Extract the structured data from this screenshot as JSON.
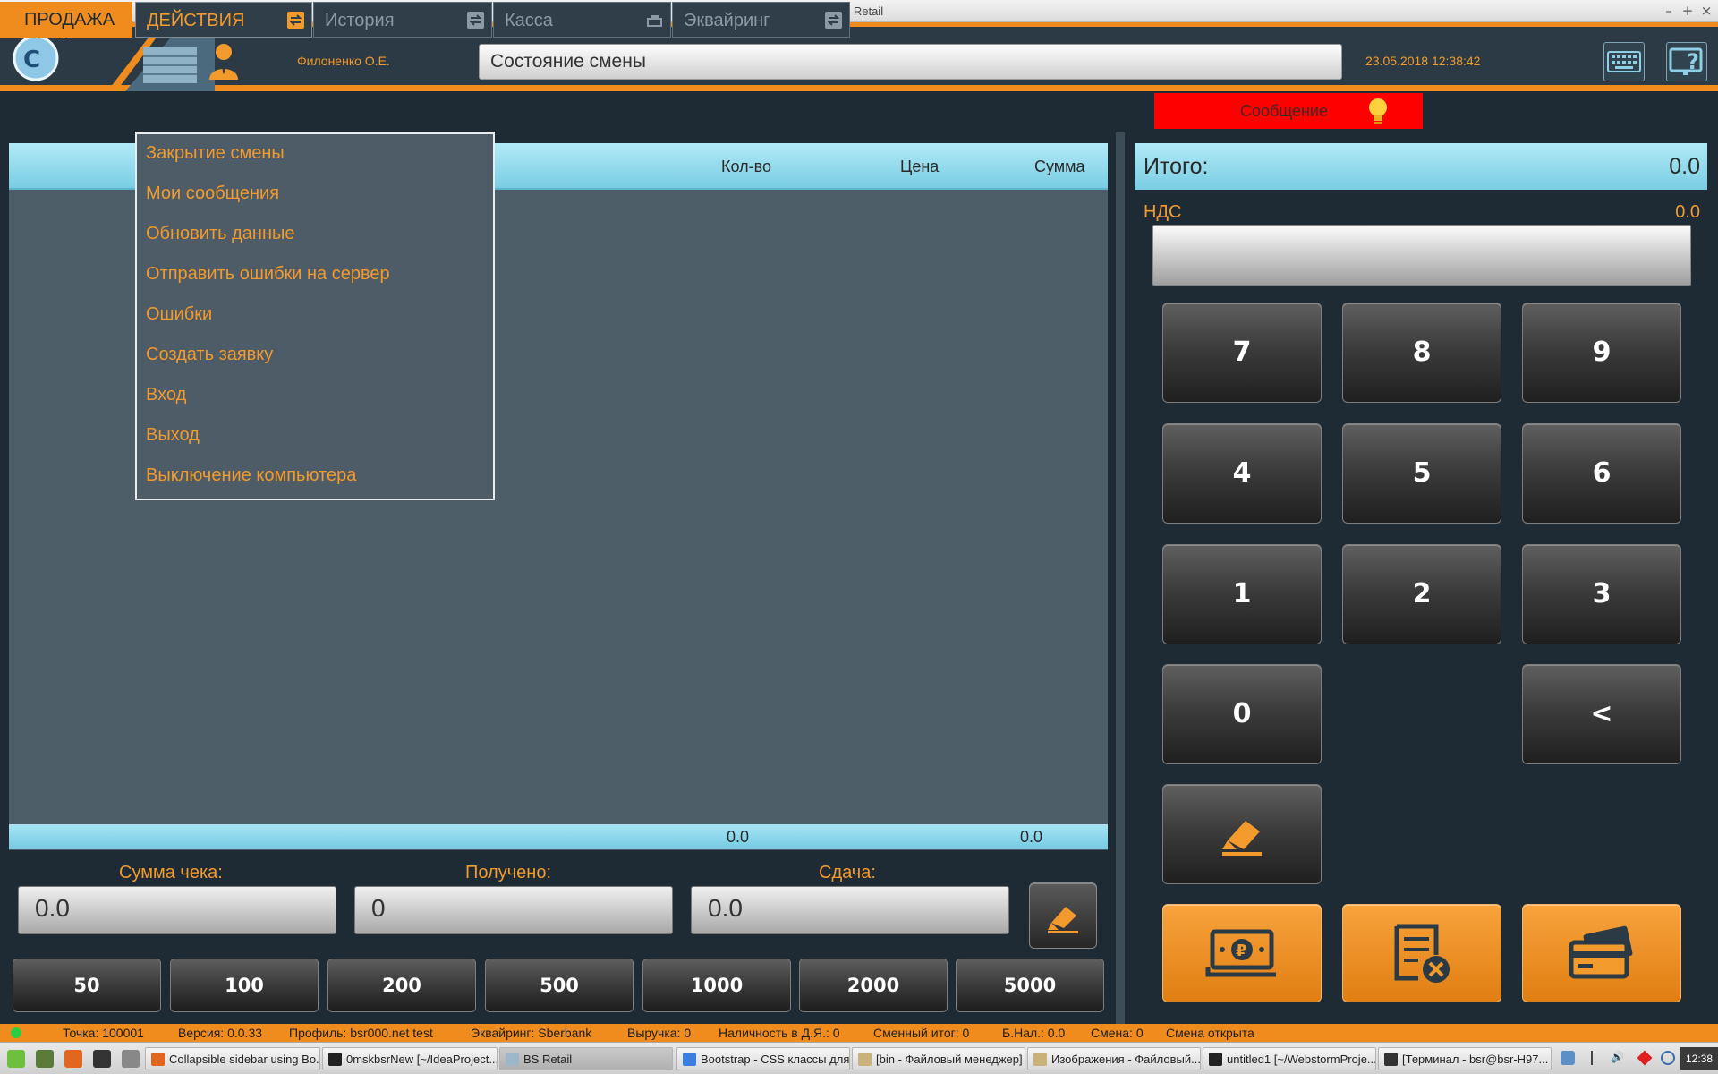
{
  "window": {
    "title": "BS Retail"
  },
  "header": {
    "user_name": "Филоненко О.Е.",
    "shift_state": "Состояние смены",
    "datetime": "23.05.2018 12:38:42"
  },
  "tabs": {
    "sale": "ПРОДАЖА",
    "actions": "ДЕЙСТВИЯ",
    "history": "История",
    "cash": "Касса",
    "acquiring": "Эквайринг"
  },
  "message_label": "Сообщение",
  "actions_menu": [
    "Закрытие смены",
    "Мои сообщения",
    "Обновить данные",
    "Отправить ошибки на сервер",
    "Ошибки",
    "Создать заявку",
    "Вход",
    "Выход",
    "Выключение компьютера"
  ],
  "table": {
    "col_qty": "Кол-во",
    "col_price": "Цена",
    "col_sum": "Сумма",
    "foot_qty": "0.0",
    "foot_sum": "0.0"
  },
  "payment": {
    "receipt_sum_label": "Сумма чека:",
    "receipt_sum": "0.0",
    "received_label": "Получено:",
    "received": "0",
    "change_label": "Сдача:",
    "change": "0.0"
  },
  "quick_amounts": [
    "50",
    "100",
    "200",
    "500",
    "1000",
    "2000",
    "5000"
  ],
  "totals": {
    "total_label": "Итого:",
    "total": "0.0",
    "vat_label": "НДС",
    "vat": "0.0"
  },
  "keypad": {
    "k7": "7",
    "k8": "8",
    "k9": "9",
    "k4": "4",
    "k5": "5",
    "k6": "6",
    "k1": "1",
    "k2": "2",
    "k3": "3",
    "k0": "0",
    "back": "<"
  },
  "status": {
    "point": "Точка: 100001",
    "version": "Версия: 0.0.33",
    "profile": "Профиль: bsr000.net test",
    "acquiring": "Эквайринг: Sberbank",
    "revenue": "Выручка: 0",
    "cash_in_drawer": "Наличность в Д.Я.: 0",
    "shift_total": "Сменный итог: 0",
    "cashless": "Б.Нал.: 0.0",
    "shift": "Смена: 0",
    "shift_open": "Смена открыта"
  },
  "taskbar": {
    "tasks": [
      "Collapsible sidebar using Bo...",
      "0mskbsrNew [~/IdeaProject...",
      "BS Retail",
      "Bootstrap - CSS классы для...",
      "[bin - Файловый менеджер]",
      "Изображения - Файловый...",
      "untitled1 [~/WebstormProje...",
      "[Терминал - bsr@bsr-H97..."
    ],
    "clock": "12:38"
  },
  "colors": {
    "accent": "#f08c1e",
    "panel": "#4e5e69",
    "header_blue": "#8fd8ec",
    "alert": "#fe0000"
  }
}
